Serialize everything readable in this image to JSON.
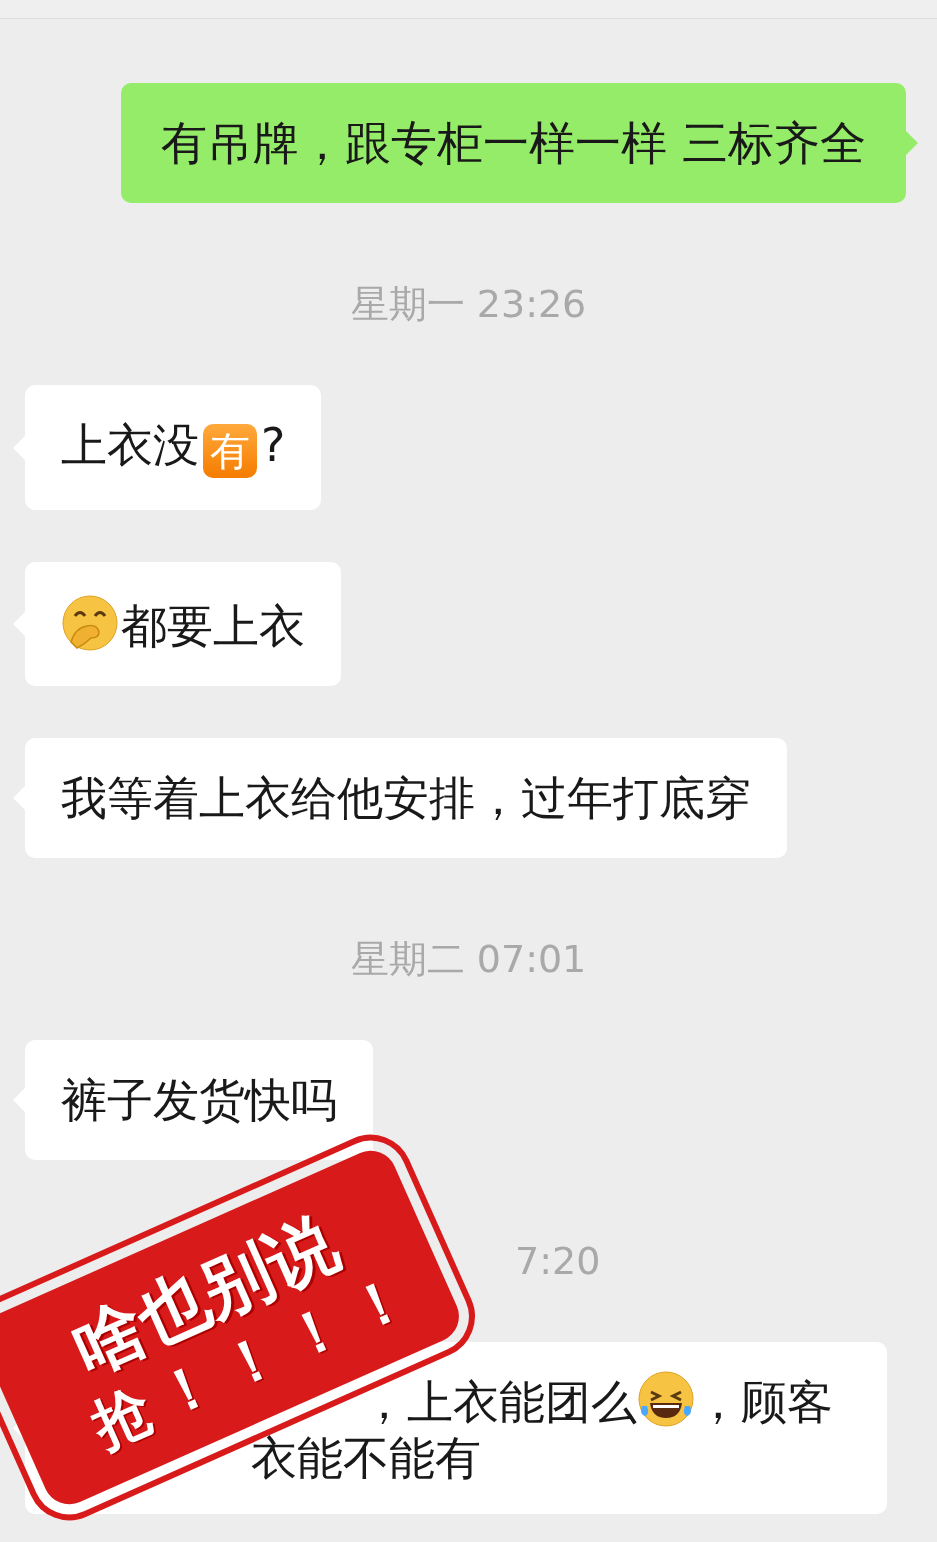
{
  "messages": [
    {
      "kind": "outgoing",
      "lines": [
        [
          {
            "kind": "text",
            "text": "有吊牌，跟专柜一样一样 三标齐全"
          }
        ]
      ]
    },
    {
      "kind": "time",
      "text": "星期一 23:26"
    },
    {
      "kind": "incoming",
      "lines": [
        [
          {
            "kind": "text",
            "text": "上衣没"
          },
          {
            "kind": "badge",
            "text": "有"
          },
          {
            "kind": "text",
            "text": "?"
          }
        ]
      ]
    },
    {
      "kind": "incoming",
      "lines": [
        [
          {
            "kind": "cover-mouth-emoji"
          },
          {
            "kind": "text",
            "text": "都要上衣"
          }
        ]
      ]
    },
    {
      "kind": "incoming",
      "lines": [
        [
          {
            "kind": "text",
            "text": "我等着上衣给他安排，过年打底穿"
          }
        ]
      ]
    },
    {
      "kind": "time",
      "text": "星期二 07:01"
    },
    {
      "kind": "incoming",
      "lines": [
        [
          {
            "kind": "text",
            "text": "裤子发货快吗"
          }
        ]
      ]
    },
    {
      "kind": "time",
      "covered": true,
      "text": "7:20"
    },
    {
      "kind": "incoming",
      "covered": true,
      "lines": [
        [
          {
            "kind": "text",
            "text": "，上衣能团么"
          },
          {
            "kind": "laugh-emoji"
          },
          {
            "kind": "text",
            "text": "，顾客"
          }
        ],
        [
          {
            "kind": "text",
            "text": "衣能不能有"
          }
        ]
      ]
    }
  ],
  "stamp": {
    "lines": [
      "啥也别说",
      "抢！！！！"
    ]
  }
}
